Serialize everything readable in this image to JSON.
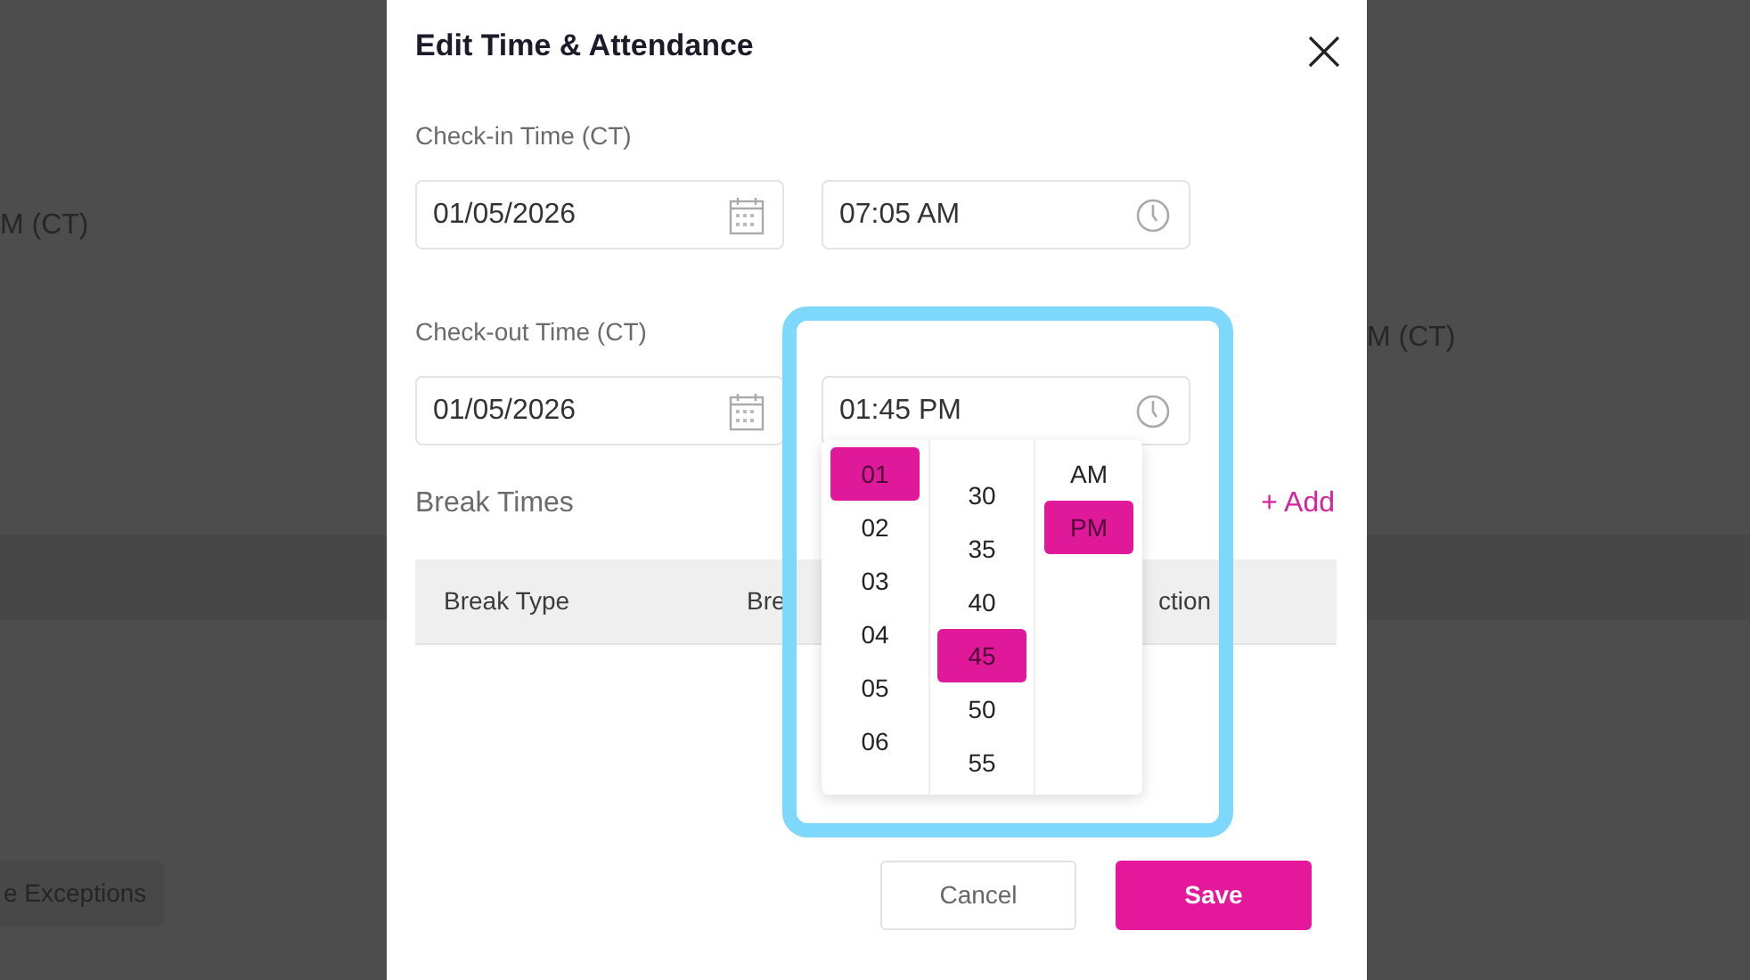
{
  "background": {
    "texts": [
      "M (CT)",
      "M (CT)"
    ],
    "button": "e Exceptions"
  },
  "dialog": {
    "title": "Edit Time & Attendance",
    "check_in": {
      "label": "Check-in Time (CT)",
      "date": "01/05/2026",
      "time": "07:05 AM"
    },
    "check_out": {
      "label": "Check-out Time (CT)",
      "date": "01/05/2026",
      "time": "01:45 PM"
    },
    "break_times": {
      "title": "Break Times",
      "add": "+ Add",
      "columns": [
        "Break Type",
        "Bre",
        "ction"
      ]
    },
    "time_picker": {
      "hours": [
        {
          "label": "01",
          "selected": true
        },
        {
          "label": "02",
          "selected": false
        },
        {
          "label": "03",
          "selected": false
        },
        {
          "label": "04",
          "selected": false
        },
        {
          "label": "05",
          "selected": false
        },
        {
          "label": "06",
          "selected": false
        }
      ],
      "minutes": [
        {
          "label": "30",
          "selected": false
        },
        {
          "label": "35",
          "selected": false
        },
        {
          "label": "40",
          "selected": false
        },
        {
          "label": "45",
          "selected": true
        },
        {
          "label": "50",
          "selected": false
        },
        {
          "label": "55",
          "selected": false
        }
      ],
      "periods": [
        {
          "label": "AM",
          "selected": false
        },
        {
          "label": "PM",
          "selected": true
        }
      ]
    },
    "buttons": [
      {
        "label": "Cancel",
        "kind": "secondary"
      },
      {
        "label": "Save",
        "kind": "primary"
      }
    ]
  }
}
